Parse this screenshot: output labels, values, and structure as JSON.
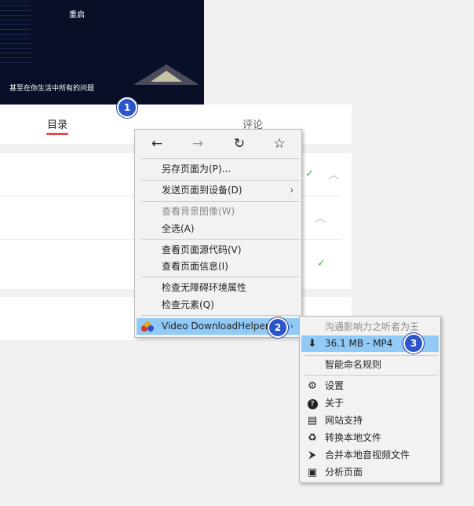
{
  "video": {
    "top_text": "重启",
    "subtitle": "甚至在你生活中所有的问题"
  },
  "tabs": {
    "active": "目录",
    "other": "评论"
  },
  "badges": [
    "1",
    "2",
    "3"
  ],
  "context_menu": {
    "nav": {
      "back": "←",
      "forward": "→",
      "reload": "↻",
      "bookmark": "☆"
    },
    "items": {
      "save_page": "另存页面为(P)...",
      "send_to_device": "发送页面到设备(D)",
      "view_bg_image": "查看背景图像(W)",
      "select_all": "全选(A)",
      "view_source": "查看页面源代码(V)",
      "page_info": "查看页面信息(I)",
      "accessibility": "检查无障碍环境属性",
      "inspect": "检查元素(Q)",
      "vdh": "Video DownloadHelper"
    },
    "submenu_arrow": "›"
  },
  "submenu": {
    "header": "沟通影响力之听者为王",
    "download": "36.1 MB - MP4",
    "smart_naming": "智能命名规则",
    "settings": "设置",
    "about": "关于",
    "sites": "网站支持",
    "convert": "转换本地文件",
    "merge": "合并本地音视频文件",
    "analyze": "分析页面"
  },
  "icons": {
    "download": "⬇",
    "settings": "⚙",
    "about": "?",
    "sites": "▤",
    "convert": "♻",
    "merge": "⮞",
    "analyze": "▣"
  },
  "colors": {
    "highlight": "#91c9f7",
    "badge": "#2b55c9",
    "tab_underline": "#e5484d",
    "check": "#3db34a"
  }
}
